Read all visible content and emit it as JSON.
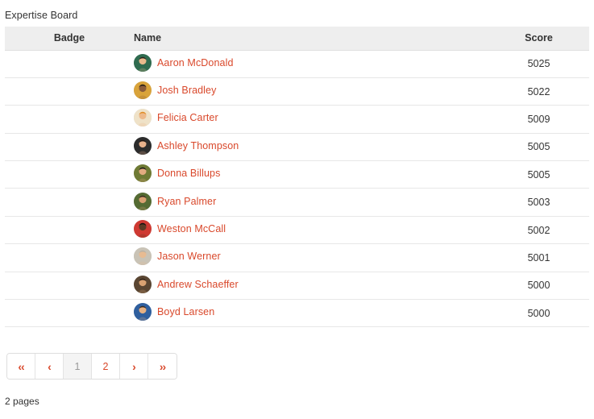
{
  "board": {
    "title": "Expertise Board",
    "columns": {
      "badge": "Badge",
      "name": "Name",
      "score": "Score"
    },
    "rows": [
      {
        "name": "Aaron McDonald",
        "score": "5025",
        "avatar_bg": "#2f6b4f",
        "avatar_skin": "#e9b98c",
        "avatar_hair": "#2b2118"
      },
      {
        "name": "Josh Bradley",
        "score": "5022",
        "avatar_bg": "#d9a33a",
        "avatar_skin": "#8a5b3a",
        "avatar_hair": "#1e1712"
      },
      {
        "name": "Felicia Carter",
        "score": "5009",
        "avatar_bg": "#efe2c8",
        "avatar_skin": "#edb98a",
        "avatar_hair": "#e08a22"
      },
      {
        "name": "Ashley Thompson",
        "score": "5005",
        "avatar_bg": "#2c2c2c",
        "avatar_skin": "#e7b18b",
        "avatar_hair": "#201612"
      },
      {
        "name": "Donna Billups",
        "score": "5005",
        "avatar_bg": "#6f7a34",
        "avatar_skin": "#e3ab80",
        "avatar_hair": "#141414"
      },
      {
        "name": "Ryan Palmer",
        "score": "5003",
        "avatar_bg": "#556b33",
        "avatar_skin": "#d9a172",
        "avatar_hair": "#3a2b1e"
      },
      {
        "name": "Weston McCall",
        "score": "5002",
        "avatar_bg": "#cf3a32",
        "avatar_skin": "#5b3a24",
        "avatar_hair": "#14100d"
      },
      {
        "name": "Jason Werner",
        "score": "5001",
        "avatar_bg": "#c9c3b6",
        "avatar_skin": "#e7bb92",
        "avatar_hair": "#b9b2a6"
      },
      {
        "name": "Andrew Schaeffer",
        "score": "5000",
        "avatar_bg": "#5a4632",
        "avatar_skin": "#d9a272",
        "avatar_hair": "#2a1d14"
      },
      {
        "name": "Boyd Larsen",
        "score": "5000",
        "avatar_bg": "#2f5f9e",
        "avatar_skin": "#e6b183",
        "avatar_hair": "#3b2a1c"
      }
    ]
  },
  "pagination": {
    "first_label": "‹‹",
    "prev_label": "‹",
    "next_label": "›",
    "last_label": "››",
    "pages": [
      "1",
      "2"
    ],
    "current_page": "1",
    "pages_summary": "2 pages"
  },
  "colors": {
    "link": "#d9482b",
    "header_bg": "#eeeeee",
    "row_border": "#e7e7e7",
    "active_page_bg": "#f4f4f4",
    "text": "#333333"
  }
}
